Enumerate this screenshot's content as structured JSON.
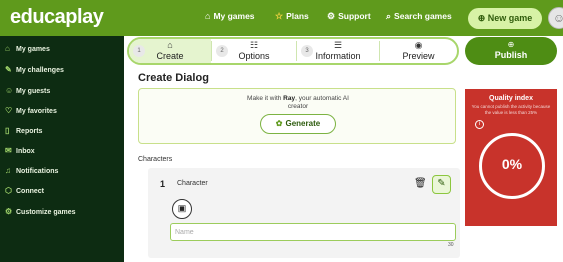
{
  "app": {
    "logo": "educaplay"
  },
  "topnav": {
    "my_games": {
      "icon": "home-icon",
      "glyph": "⌂",
      "label": "My games"
    },
    "plans": {
      "icon": "star-icon",
      "glyph": "☆",
      "label": "Plans"
    },
    "support": {
      "icon": "gear-icon",
      "glyph": "⚙",
      "label": "Support"
    },
    "search_games": {
      "icon": "search-games-icon",
      "glyph": "⌕",
      "label": "Search games"
    },
    "new_game": {
      "icon": "new-game-icon",
      "glyph": "⊕",
      "label": "New game"
    }
  },
  "sidebar": {
    "items": [
      {
        "icon": "games-icon",
        "glyph": "⌂",
        "label": "My games"
      },
      {
        "icon": "challenges-icon",
        "glyph": "✎",
        "label": "My challenges"
      },
      {
        "icon": "guests-icon",
        "glyph": "☺",
        "label": "My guests"
      },
      {
        "icon": "heart-icon",
        "glyph": "♡",
        "label": "My favorites"
      },
      {
        "icon": "reports-icon",
        "glyph": "▯",
        "label": "Reports"
      },
      {
        "icon": "inbox-icon",
        "glyph": "✉",
        "label": "Inbox"
      },
      {
        "icon": "bell-icon",
        "glyph": "♫",
        "label": "Notifications"
      },
      {
        "icon": "connect-icon",
        "glyph": "⬡",
        "label": "Connect"
      },
      {
        "icon": "customize-icon",
        "glyph": "⚙",
        "label": "Customize games"
      }
    ]
  },
  "stepper": {
    "steps": [
      {
        "num": "1",
        "glyph": "⌂",
        "label": "Create"
      },
      {
        "num": "2",
        "glyph": "☷",
        "label": "Options"
      },
      {
        "num": "3",
        "glyph": "☰",
        "label": "Information"
      },
      {
        "num": "",
        "glyph": "◉",
        "label": "Preview"
      }
    ]
  },
  "publish": {
    "glyph": "⊕",
    "label": "Publish"
  },
  "page_title": "Create Dialog",
  "ai": {
    "prefix": "Make it with ",
    "name": "Ray",
    "suffix": ", your automatic AI",
    "line2": "creator",
    "button_glyph": "✿",
    "button_label": "Generate"
  },
  "quality": {
    "title": "Quality index",
    "subtitle": "You cannot publish the activity because the value is less than 25%",
    "info_glyph": "i",
    "value": "0%",
    "score_percent": 0
  },
  "characters": {
    "label": "Characters",
    "items": [
      {
        "num": "1",
        "name": "Character"
      }
    ],
    "trash_glyph": "🗑",
    "edit_glyph": "✎",
    "image_glyph": "▣",
    "name_placeholder": "Name",
    "name_value": "",
    "counter": "30"
  },
  "colors": {
    "brand_green": "#5f9a1c",
    "sidebar_bg": "#0d2c12",
    "publish_green": "#4e8d14",
    "quality_red": "#c8332b",
    "accent_light_green": "#a8d66b"
  }
}
